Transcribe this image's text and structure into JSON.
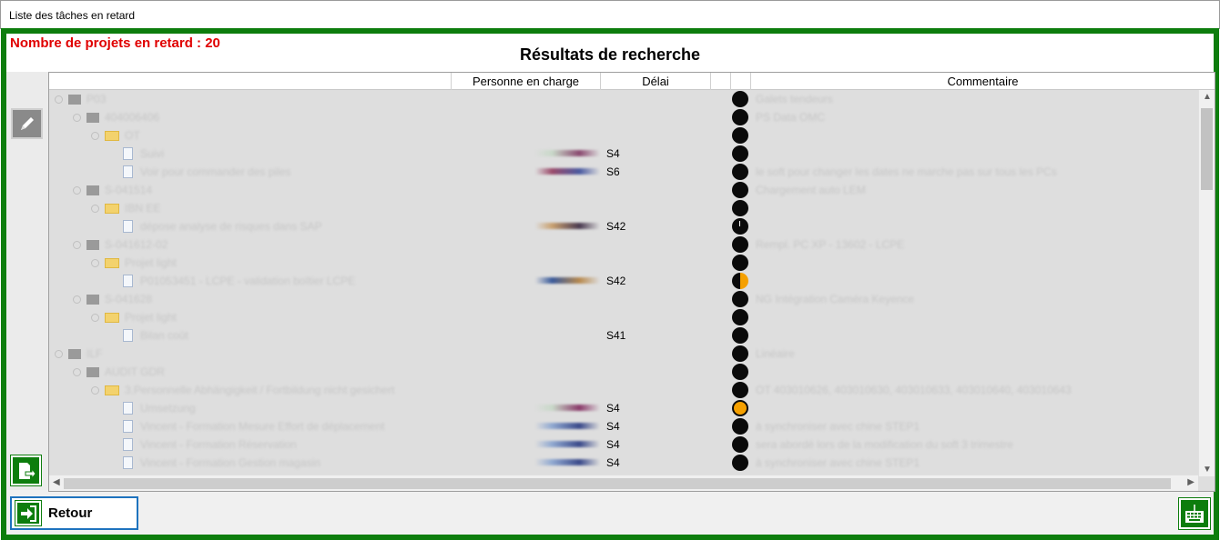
{
  "window": {
    "title": "Liste des tâches en retard"
  },
  "header": {
    "late_count_label": "Nombre de projets en retard : 20",
    "results_title": "Résultats de recherche"
  },
  "columns": {
    "person": "Personne en charge",
    "delay": "Délai",
    "comment": "Commentaire"
  },
  "rows": [
    {
      "level": 0,
      "type": "project",
      "label": "P03",
      "delay": "",
      "status": "black",
      "comment": "Galets tendeurs",
      "person_colors": null
    },
    {
      "level": 1,
      "type": "project",
      "label": "404006406",
      "delay": "",
      "status": "black",
      "comment": "PS Data OMC",
      "person_colors": null
    },
    {
      "level": 2,
      "type": "folder",
      "label": "OT",
      "delay": "",
      "status": "black",
      "comment": "",
      "person_colors": null
    },
    {
      "level": 3,
      "type": "task",
      "label": "Suivi",
      "delay": "S4",
      "status": "black",
      "comment": "",
      "person_colors": [
        "#c8d8c8",
        "#8a4a70"
      ]
    },
    {
      "level": 3,
      "type": "task",
      "label": "Voir pour commander des piles",
      "delay": "S6",
      "status": "black",
      "comment": "le soft pour changer les dates ne marche pas sur tous les PCs",
      "person_colors": [
        "#9a4a6a",
        "#4a5aa0"
      ]
    },
    {
      "level": 1,
      "type": "project",
      "label": "S-041514",
      "delay": "",
      "status": "black",
      "comment": "Chargement auto LEM",
      "person_colors": null
    },
    {
      "level": 2,
      "type": "folder",
      "label": "IBN EE",
      "delay": "",
      "status": "black",
      "comment": "",
      "person_colors": null
    },
    {
      "level": 3,
      "type": "task",
      "label": "dépose analyse de risques dans SAP",
      "delay": "S42",
      "status": "black-tick",
      "comment": "",
      "person_colors": [
        "#c8a070",
        "#4a3a50"
      ]
    },
    {
      "level": 1,
      "type": "project",
      "label": "S-041612-02",
      "delay": "",
      "status": "black",
      "comment": "Rempl. PC XP - 13602 - LCPE",
      "person_colors": null
    },
    {
      "level": 2,
      "type": "folder",
      "label": "Projet light",
      "delay": "",
      "status": "black",
      "comment": "",
      "person_colors": null
    },
    {
      "level": 3,
      "type": "task",
      "label": "P01053451 - LCPE - validation boîtier LCPE",
      "delay": "S42",
      "status": "half",
      "comment": "",
      "person_colors": [
        "#3a5a9a",
        "#b88a50"
      ]
    },
    {
      "level": 1,
      "type": "project",
      "label": "S-041628",
      "delay": "",
      "status": "black",
      "comment": "NG Intégration Caméra Keyence",
      "person_colors": null
    },
    {
      "level": 2,
      "type": "folder",
      "label": "Projet light",
      "delay": "",
      "status": "black",
      "comment": "",
      "person_colors": null
    },
    {
      "level": 3,
      "type": "task",
      "label": "Bilan coût",
      "delay": "S41",
      "status": "black",
      "comment": "",
      "person_colors": null
    },
    {
      "level": 0,
      "type": "project",
      "label": "ILF",
      "delay": "",
      "status": "black",
      "comment": "Linéaire",
      "person_colors": null
    },
    {
      "level": 1,
      "type": "project",
      "label": "AUDIT GDR",
      "delay": "",
      "status": "black",
      "comment": "",
      "person_colors": null
    },
    {
      "level": 2,
      "type": "folder",
      "label": "3.Personnelle Abhängigkeit / Fortbildung nicht gesichert",
      "delay": "",
      "status": "black",
      "comment": "OT 403010626, 403010630, 403010633, 403010640, 403010643",
      "person_colors": null
    },
    {
      "level": 3,
      "type": "task",
      "label": "Umsetzung",
      "delay": "S4",
      "status": "mostly-orange",
      "comment": "",
      "person_colors": [
        "#c8d8c8",
        "#8a3a6a"
      ]
    },
    {
      "level": 3,
      "type": "task",
      "label": "Vincent - Formation Mesure Effort de déplacement",
      "delay": "S4",
      "status": "black",
      "comment": "à synchroniser avec chine STEP1",
      "person_colors": [
        "#90a8d0",
        "#3a4a8a"
      ]
    },
    {
      "level": 3,
      "type": "task",
      "label": "Vincent - Formation Réservation",
      "delay": "S4",
      "status": "black",
      "comment": "sera abordé lors de la modification du soft 3 trimestre",
      "person_colors": [
        "#90a8d0",
        "#3a4a8a"
      ]
    },
    {
      "level": 3,
      "type": "task",
      "label": "Vincent - Formation Gestion magasin",
      "delay": "S4",
      "status": "black",
      "comment": "à synchroniser avec chine STEP1",
      "person_colors": [
        "#90a8d0",
        "#3a4a8a"
      ]
    }
  ],
  "footer": {
    "retour_label": "Retour"
  },
  "icons": {
    "edit": "pencil-icon",
    "export": "export-document-icon",
    "retour": "exit-arrow-icon",
    "keyboard": "keyboard-icon"
  },
  "colors": {
    "frame": "#0d7d0d",
    "alert_text": "#e00000",
    "status_orange": "#f5a000"
  }
}
